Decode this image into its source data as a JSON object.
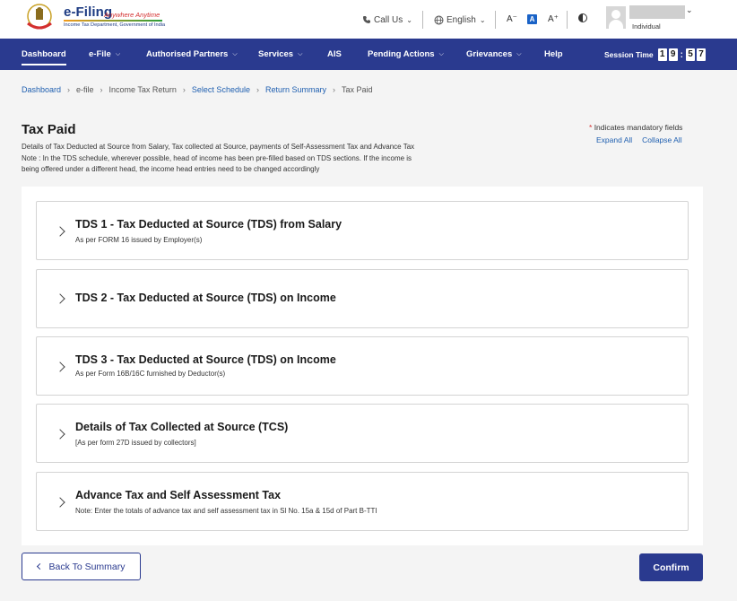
{
  "header": {
    "logo_title": "e-Filing",
    "logo_tagline": "Anywhere Anytime",
    "logo_subtitle": "Income Tax Department, Government of India",
    "call_us": "Call Us",
    "language": "English",
    "font_decrease": "A⁻",
    "font_normal": "A",
    "font_increase": "A⁺",
    "user_role": "Individual"
  },
  "nav": {
    "items": [
      {
        "label": "Dashboard"
      },
      {
        "label": "e-File"
      },
      {
        "label": "Authorised Partners"
      },
      {
        "label": "Services"
      },
      {
        "label": "AIS"
      },
      {
        "label": "Pending Actions"
      },
      {
        "label": "Grievances"
      },
      {
        "label": "Help"
      }
    ],
    "session_label": "Session Time",
    "session_digits": [
      "1",
      "9",
      "5",
      "7"
    ]
  },
  "breadcrumb": {
    "items": [
      {
        "label": "Dashboard"
      },
      {
        "label": "e-file"
      },
      {
        "label": "Income Tax Return"
      },
      {
        "label": "Select Schedule"
      },
      {
        "label": "Return Summary"
      },
      {
        "label": "Tax Paid"
      }
    ]
  },
  "page": {
    "title": "Tax Paid",
    "description_line1": "Details of Tax Deducted at Source from Salary, Tax collected at Source, payments of Self-Assessment Tax and Advance Tax",
    "description_line2": "Note : In the TDS schedule, wherever possible, head of income has been pre-filled based on TDS sections. If the income is",
    "description_line3": "being offered under a different head, the income head entries need to be changed accordingly",
    "mandatory_star": "*",
    "mandatory_text": "Indicates mandatory fields",
    "expand_all": "Expand All",
    "collapse_all": "Collapse All"
  },
  "sections": [
    {
      "title": "TDS 1 - Tax Deducted at Source (TDS) from Salary",
      "subtitle": "As per FORM 16 issued by Employer(s)"
    },
    {
      "title": "TDS 2 - Tax Deducted at Source (TDS) on Income",
      "subtitle": ""
    },
    {
      "title": "TDS 3 - Tax Deducted at Source (TDS) on Income",
      "subtitle": "As per Form 16B/16C furnished by Deductor(s)"
    },
    {
      "title": "Details of Tax Collected at Source (TCS)",
      "subtitle": "[As per form 27D issued by collectors]"
    },
    {
      "title": "Advance Tax and Self Assessment Tax",
      "subtitle": "Note: Enter the totals of advance tax and self assessment tax in Sl No. 15a & 15d of Part B-TTI"
    }
  ],
  "footer": {
    "back_label": "Back To Summary",
    "confirm_label": "Confirm"
  },
  "colors": {
    "primary": "#2a3a8f",
    "link": "#1f5fb0",
    "mandatory": "#d32f2f"
  }
}
